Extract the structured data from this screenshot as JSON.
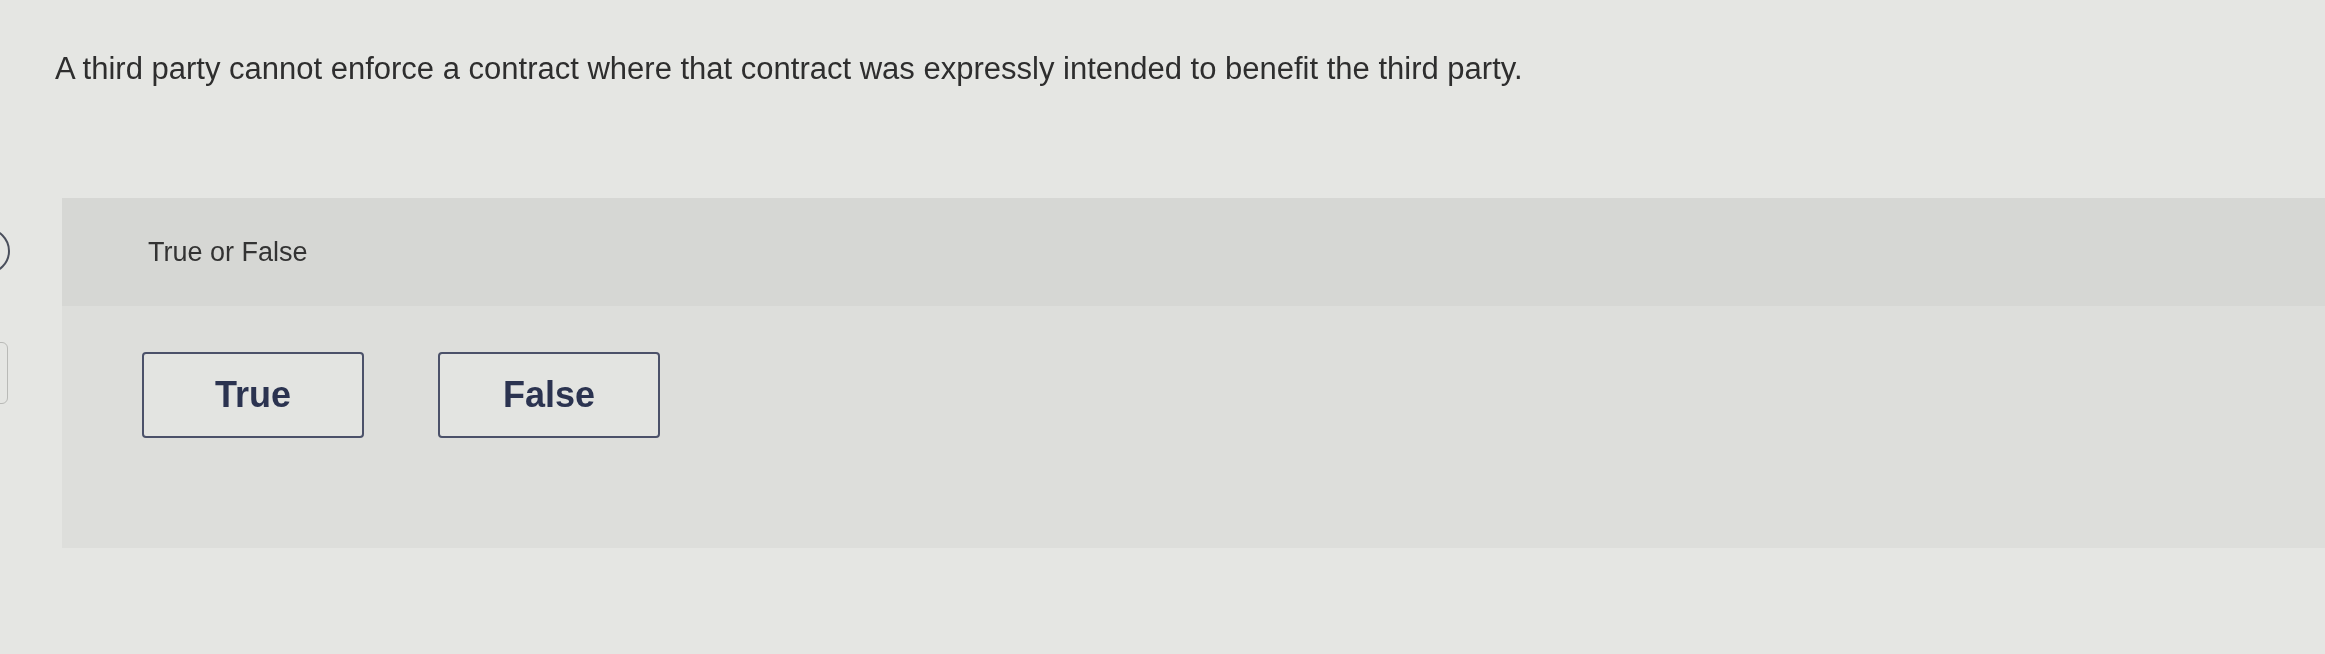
{
  "question": {
    "text": "A third party cannot enforce a contract where that contract was expressly intended to benefit the third party."
  },
  "answer_panel": {
    "prompt": "True or False",
    "options": [
      {
        "label": "True",
        "selected": false
      },
      {
        "label": "False",
        "selected": false
      }
    ]
  }
}
